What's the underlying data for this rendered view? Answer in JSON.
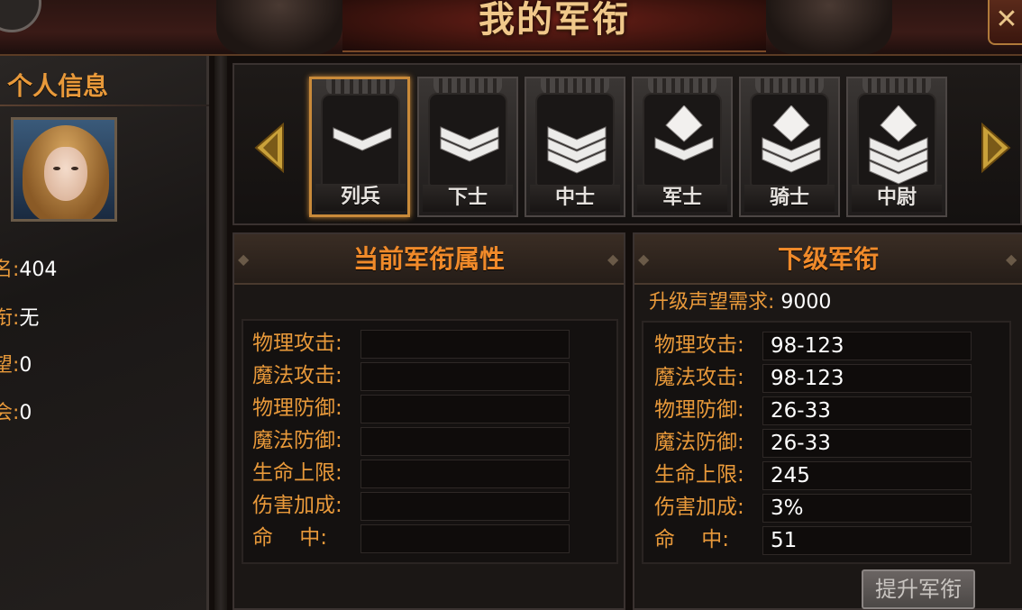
{
  "header": {
    "title": "我的军衔",
    "close_label": "✕"
  },
  "profile": {
    "section_title": "个人信息",
    "rows": [
      {
        "label": "名:",
        "value": "404"
      },
      {
        "label": "衔:",
        "value": "无"
      },
      {
        "label": "望:",
        "value": "0"
      },
      {
        "label": "会:",
        "value": "0"
      }
    ]
  },
  "ranks": {
    "items": [
      {
        "label": "列兵",
        "chevrons": 1,
        "diamond": false,
        "selected": true
      },
      {
        "label": "下士",
        "chevrons": 2,
        "diamond": false,
        "selected": false
      },
      {
        "label": "中士",
        "chevrons": 3,
        "diamond": false,
        "selected": false
      },
      {
        "label": "军士",
        "chevrons": 1,
        "diamond": true,
        "selected": false
      },
      {
        "label": "骑士",
        "chevrons": 2,
        "diamond": true,
        "selected": false
      },
      {
        "label": "中尉",
        "chevrons": 3,
        "diamond": true,
        "selected": false
      }
    ]
  },
  "current": {
    "title": "当前军衔属性",
    "stats": [
      {
        "label": "物理攻击:",
        "value": ""
      },
      {
        "label": "魔法攻击:",
        "value": ""
      },
      {
        "label": "物理防御:",
        "value": ""
      },
      {
        "label": "魔法防御:",
        "value": ""
      },
      {
        "label": "生命上限:",
        "value": ""
      },
      {
        "label": "伤害加成:",
        "value": ""
      },
      {
        "label": "命    中:",
        "value": ""
      }
    ]
  },
  "next": {
    "title": "下级军衔",
    "requirement_label": "升级声望需求:",
    "requirement_value": "9000",
    "stats": [
      {
        "label": "物理攻击:",
        "value": "98-123"
      },
      {
        "label": "魔法攻击:",
        "value": "98-123"
      },
      {
        "label": "物理防御:",
        "value": "26-33"
      },
      {
        "label": "魔法防御:",
        "value": "26-33"
      },
      {
        "label": "生命上限:",
        "value": "245"
      },
      {
        "label": "伤害加成:",
        "value": "3%"
      },
      {
        "label": "命    中:",
        "value": "51"
      }
    ],
    "upgrade_label": "提升军衔"
  },
  "colors": {
    "accent_orange": "#e8993a",
    "title_gold": "#f0c88a",
    "selected_border": "#c98a3a"
  }
}
